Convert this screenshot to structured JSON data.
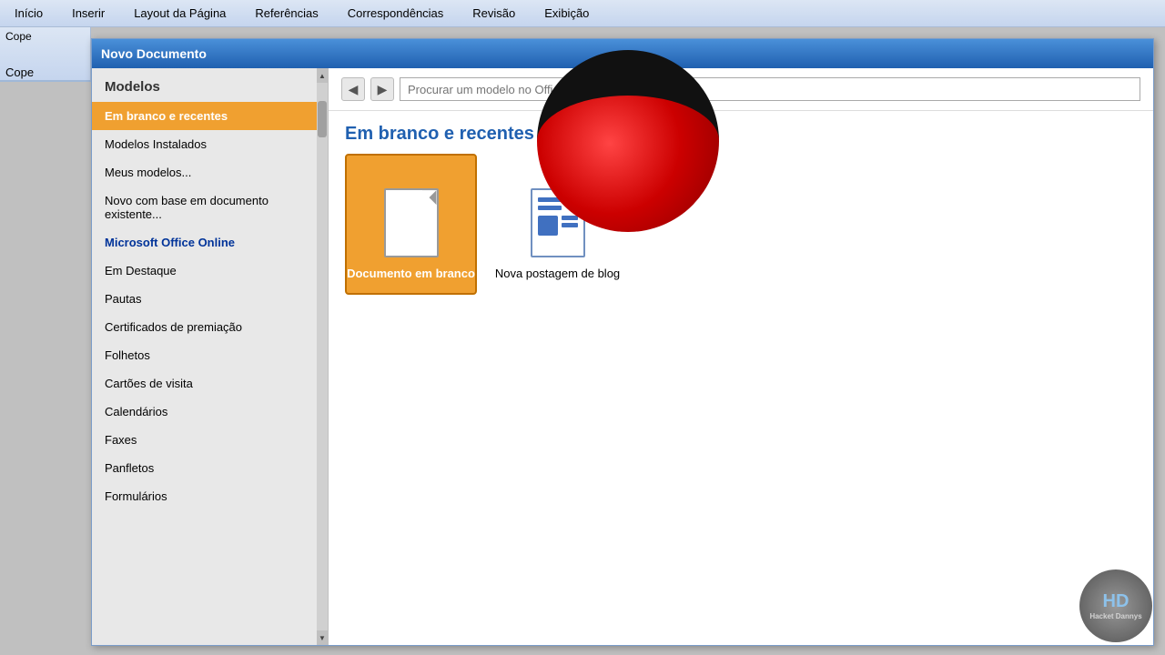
{
  "menubar": {
    "items": [
      {
        "label": "Início"
      },
      {
        "label": "Inserir"
      },
      {
        "label": "Layout da Página"
      },
      {
        "label": "Referências"
      },
      {
        "label": "Correspondências"
      },
      {
        "label": "Revisão"
      },
      {
        "label": "Exibição"
      }
    ]
  },
  "ribbon": {
    "cope_text": "Cope"
  },
  "dialog": {
    "title": "Novo Documento",
    "sidebar": {
      "header": "Modelos",
      "items": [
        {
          "label": "Em branco e recentes",
          "active": true
        },
        {
          "label": "Modelos Instalados",
          "bold": false
        },
        {
          "label": "Meus modelos...",
          "bold": false
        },
        {
          "label": "Novo com base em documento existente...",
          "bold": false
        },
        {
          "label": "Microsoft Office Online",
          "bold": true
        },
        {
          "label": "Em Destaque",
          "bold": false
        },
        {
          "label": "Pautas",
          "bold": false
        },
        {
          "label": "Certificados de premiação",
          "bold": false
        },
        {
          "label": "Folhetos",
          "bold": false
        },
        {
          "label": "Cartões de visita",
          "bold": false
        },
        {
          "label": "Calendários",
          "bold": false
        },
        {
          "label": "Faxes",
          "bold": false
        },
        {
          "label": "Panfletos",
          "bold": false
        },
        {
          "label": "Formulários",
          "bold": false
        }
      ]
    },
    "search": {
      "placeholder": "Procurar um modelo no Office Online",
      "back_btn": "◀",
      "forward_btn": "▶"
    },
    "section_title": "Em branco e recentes",
    "templates": [
      {
        "label": "Documento em branco",
        "type": "blank",
        "selected": true
      },
      {
        "label": "Nova postagem de blog",
        "type": "blog",
        "selected": false
      }
    ]
  },
  "watermark": {
    "hd_text": "HD",
    "sub_text": "Hacket Dannys"
  }
}
